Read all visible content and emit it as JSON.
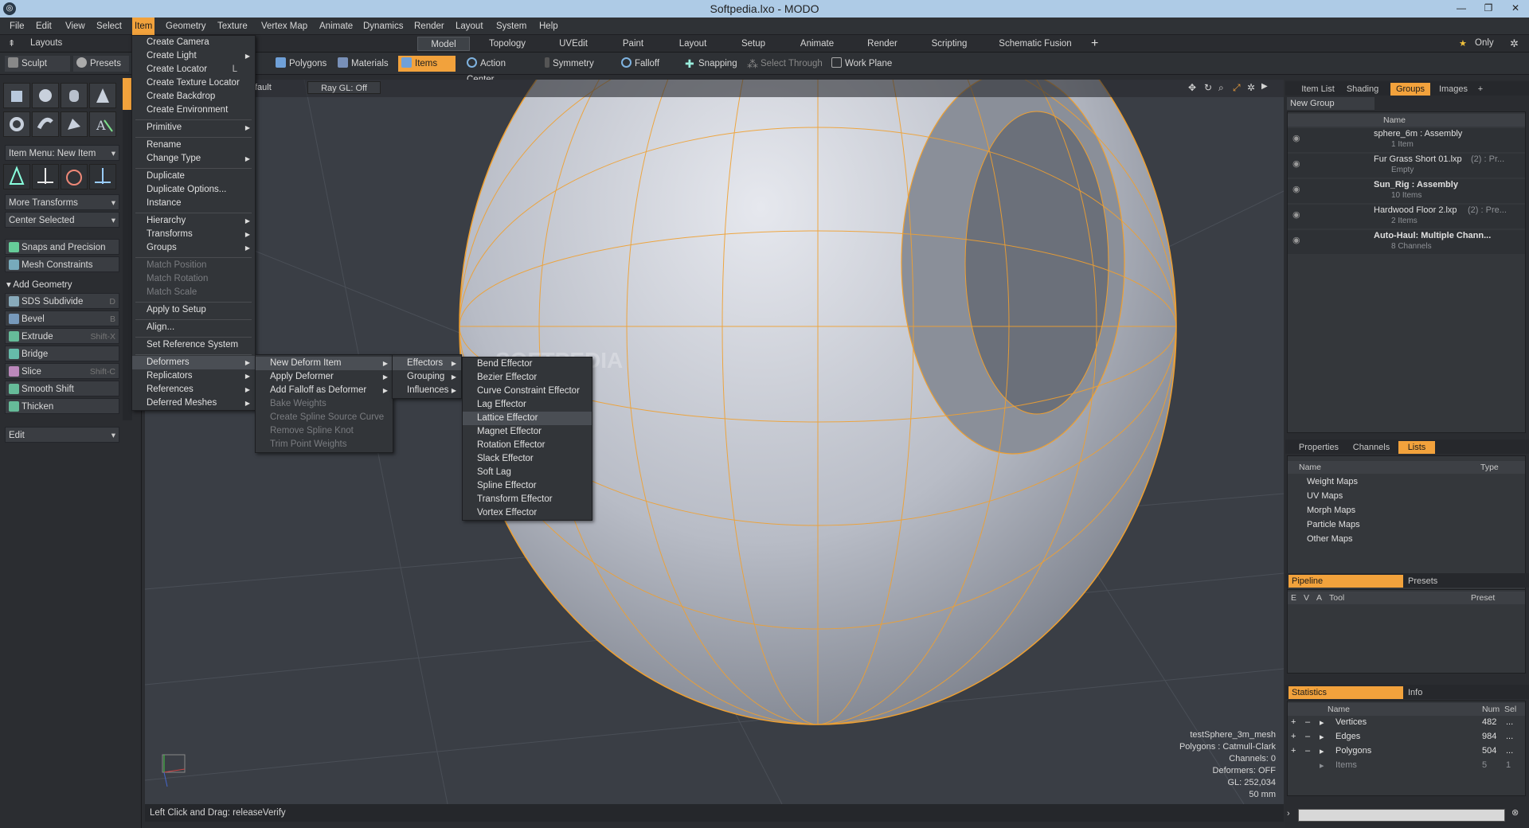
{
  "window": {
    "title": "Softpedia.lxo - MODO"
  },
  "menubar": [
    "File",
    "Edit",
    "View",
    "Select",
    "Item",
    "Geometry",
    "Texture",
    "Vertex Map",
    "Animate",
    "Dynamics",
    "Render",
    "Layout",
    "System",
    "Help"
  ],
  "layout_label": "Layouts",
  "layout_tabs": [
    "Model",
    "Topology",
    "UVEdit",
    "Paint",
    "Layout",
    "Setup",
    "Animate",
    "Render",
    "Scripting",
    "Schematic Fusion"
  ],
  "only_label": "Only",
  "toolbar": {
    "sculpt": "Sculpt",
    "presets": "Presets",
    "polygons": "Polygons",
    "materials": "Materials",
    "items": "Items",
    "action_center": "Action Center",
    "symmetry": "Symmetry",
    "falloff": "Falloff",
    "snapping": "Snapping",
    "select_through": "Select Through",
    "work_plane": "Work Plane"
  },
  "left": {
    "item_menu": "Item Menu: New Item",
    "more_transforms": "More Transforms",
    "center_selected": "Center Selected",
    "snaps": "Snaps and Precision",
    "mesh_constraints": "Mesh Constraints",
    "add_geometry": "Add Geometry",
    "tools": [
      {
        "label": "SDS Subdivide",
        "key": "D"
      },
      {
        "label": "Bevel",
        "key": "B"
      },
      {
        "label": "Extrude",
        "key": "Shift-X"
      },
      {
        "label": "Bridge",
        "key": ""
      },
      {
        "label": "Slice",
        "key": "Shift-C"
      },
      {
        "label": "Smooth Shift",
        "key": ""
      },
      {
        "label": "Thicken",
        "key": ""
      }
    ],
    "edit": "Edit"
  },
  "viewport": {
    "default": "fault",
    "raygl": "Ray GL: Off",
    "watermark": "SOFTPEDIA",
    "info": {
      "mesh": "testSphere_3m_mesh",
      "polygons": "Polygons : Catmull-Clark",
      "channels": "Channels: 0",
      "deformers": "Deformers: OFF",
      "gl": "GL: 252,034",
      "size": "50 mm"
    }
  },
  "status": "Left Click and Drag:  releaseVerify",
  "item_menu": {
    "items": [
      "Create Camera",
      "Create Light",
      "Create Locator",
      "Create Texture Locator",
      "Create Backdrop",
      "Create Environment",
      "Primitive",
      "Rename",
      "Change Type",
      "Duplicate",
      "Duplicate Options...",
      "Instance",
      "Hierarchy",
      "Transforms",
      "Groups",
      "Match Position",
      "Match Rotation",
      "Match Scale",
      "Apply to Setup",
      "Align...",
      "Set Reference System",
      "Deformers",
      "Replicators",
      "References",
      "Deferred Meshes"
    ],
    "locator_key": "L"
  },
  "deformers_menu": [
    "New Deform Item",
    "Apply Deformer",
    "Add Falloff as Deformer",
    "Bake Weights",
    "Create Spline Source Curve",
    "Remove Spline Knot",
    "Trim Point Weights"
  ],
  "new_deform_menu": [
    "Effectors",
    "Grouping",
    "Influences"
  ],
  "effectors_menu": [
    "Bend Effector",
    "Bezier Effector",
    "Curve Constraint Effector",
    "Lag Effector",
    "Lattice Effector",
    "Magnet Effector",
    "Rotation Effector",
    "Slack Effector",
    "Soft Lag",
    "Spline Effector",
    "Transform Effector",
    "Vortex Effector"
  ],
  "groups_panel": {
    "tabs": [
      "Item List",
      "Shading",
      "Groups",
      "Images"
    ],
    "new_group": "New Group",
    "name_col": "Name",
    "rows": [
      {
        "name": "sphere_6m : Assembly",
        "sub": "1 Item"
      },
      {
        "name": "Fur Grass Short 01.lxp",
        "extra": "(2) : Pr...",
        "sub": "Empty"
      },
      {
        "name": "Sun_Rig : Assembly",
        "sub": "10 Items"
      },
      {
        "name": "Hardwood Floor 2.lxp",
        "extra": "(2) : Pre...",
        "sub": "2 Items"
      },
      {
        "name": "Auto-Haul: Multiple Chann...",
        "sub": "8 Channels"
      }
    ]
  },
  "lists_panel": {
    "tabs": [
      "Properties",
      "Channels",
      "Lists"
    ],
    "name_col": "Name",
    "type_col": "Type",
    "rows": [
      "Weight Maps",
      "UV Maps",
      "Morph Maps",
      "Particle Maps",
      "Other Maps"
    ]
  },
  "pipeline_panel": {
    "tabs": [
      "Pipeline",
      "Presets"
    ],
    "cols": [
      "E",
      "V",
      "A",
      "Tool",
      "Preset"
    ]
  },
  "stats_panel": {
    "tabs": [
      "Statistics",
      "Info"
    ],
    "name_col": "Name",
    "num_col": "Num",
    "sel_col": "Sel",
    "rows": [
      {
        "name": "Vertices",
        "num": "482",
        "sel": "..."
      },
      {
        "name": "Edges",
        "num": "984",
        "sel": "..."
      },
      {
        "name": "Polygons",
        "num": "504",
        "sel": "..."
      },
      {
        "name": "Items",
        "num": "5",
        "sel": "1"
      }
    ]
  },
  "colors": {
    "accent": "#f2a23c",
    "wire": "#f0a030"
  }
}
